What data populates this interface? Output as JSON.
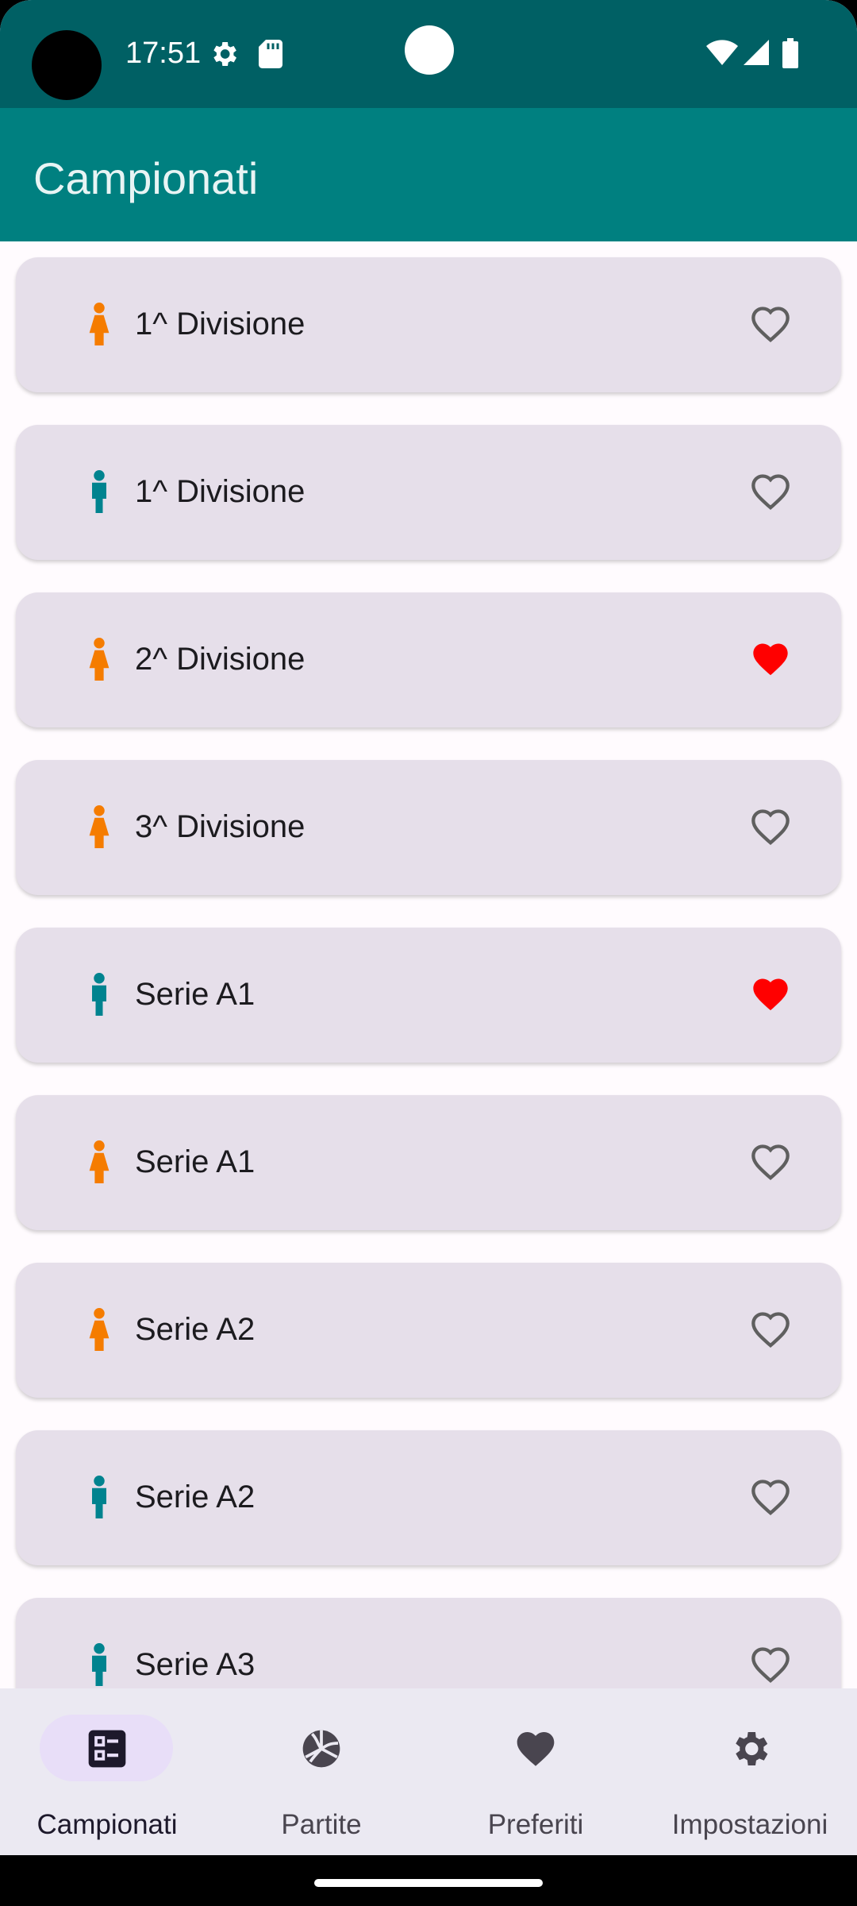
{
  "status_bar": {
    "time": "17:51",
    "icons": [
      "settings-gear-icon",
      "sd-card-icon",
      "wifi-icon",
      "cell-signal-icon",
      "battery-icon"
    ]
  },
  "app_bar": {
    "title": "Campionati"
  },
  "colors": {
    "status_bar": "#006064",
    "app_bar": "#008080",
    "female": "#f57c00",
    "male": "#00838f",
    "favorite_on": "#ff0000",
    "favorite_off": "#5f5f5f"
  },
  "championships": [
    {
      "label": "1^ Divisione",
      "gender": "female",
      "favorite": false
    },
    {
      "label": "1^ Divisione",
      "gender": "male",
      "favorite": false
    },
    {
      "label": "2^ Divisione",
      "gender": "female",
      "favorite": true
    },
    {
      "label": "3^ Divisione",
      "gender": "female",
      "favorite": false
    },
    {
      "label": "Serie A1",
      "gender": "male",
      "favorite": true
    },
    {
      "label": "Serie A1",
      "gender": "female",
      "favorite": false
    },
    {
      "label": "Serie A2",
      "gender": "female",
      "favorite": false
    },
    {
      "label": "Serie A2",
      "gender": "male",
      "favorite": false
    },
    {
      "label": "Serie A3",
      "gender": "male",
      "favorite": false
    }
  ],
  "bottom_nav": {
    "items": [
      {
        "label": "Campionati",
        "icon": "list-icon",
        "active": true
      },
      {
        "label": "Partite",
        "icon": "volleyball-icon",
        "active": false
      },
      {
        "label": "Preferiti",
        "icon": "heart-icon",
        "active": false
      },
      {
        "label": "Impostazioni",
        "icon": "settings-icon",
        "active": false
      }
    ]
  }
}
